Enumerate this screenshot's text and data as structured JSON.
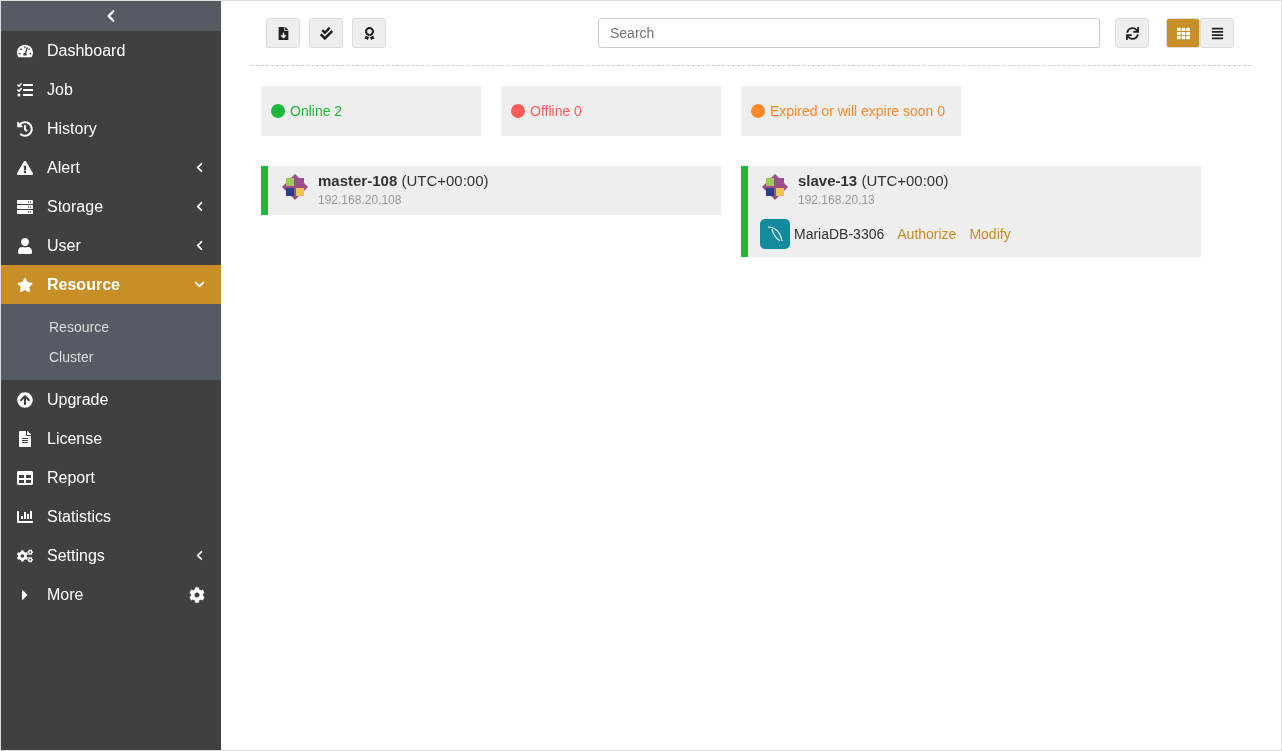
{
  "sidebar": {
    "items": [
      {
        "label": "Dashboard",
        "selected": false
      },
      {
        "label": "Job",
        "selected": false
      },
      {
        "label": "History",
        "selected": false
      },
      {
        "label": "Alert",
        "selected": false,
        "expanded": false
      },
      {
        "label": "Storage",
        "selected": false,
        "expanded": false
      },
      {
        "label": "User",
        "selected": false,
        "expanded": false
      },
      {
        "label": "Resource",
        "selected": true,
        "expanded": true,
        "children": [
          {
            "label": "Resource"
          },
          {
            "label": "Cluster"
          }
        ]
      },
      {
        "label": "Upgrade",
        "selected": false
      },
      {
        "label": "License",
        "selected": false
      },
      {
        "label": "Report",
        "selected": false
      },
      {
        "label": "Statistics",
        "selected": false
      },
      {
        "label": "Settings",
        "selected": false,
        "expanded": false
      },
      {
        "label": "More",
        "selected": false
      }
    ]
  },
  "toolbar": {
    "search": {
      "placeholder": "Search"
    },
    "views": [
      {
        "selected": true
      },
      {
        "selected": false
      }
    ]
  },
  "filters": [
    {
      "label": "Online 2",
      "color": "#1db83b"
    },
    {
      "label": "Offline 0",
      "color": "#ff5c5c"
    },
    {
      "label": "Expired or will expire soon 0",
      "color": "#ff8a2a"
    }
  ],
  "hosts": [
    {
      "name": "master-108",
      "timezone": "(UTC+00:00)",
      "ip": "192.168.20.108",
      "color": "#1db83b"
    },
    {
      "name": "slave-13",
      "timezone": "(UTC+00:00)",
      "ip": "192.168.20.13",
      "color": "#1db83b",
      "resources": [
        {
          "kind": "mariadb",
          "name": "MariaDB-3306",
          "actions": [
            "Authorize",
            "Modify"
          ]
        }
      ]
    }
  ]
}
